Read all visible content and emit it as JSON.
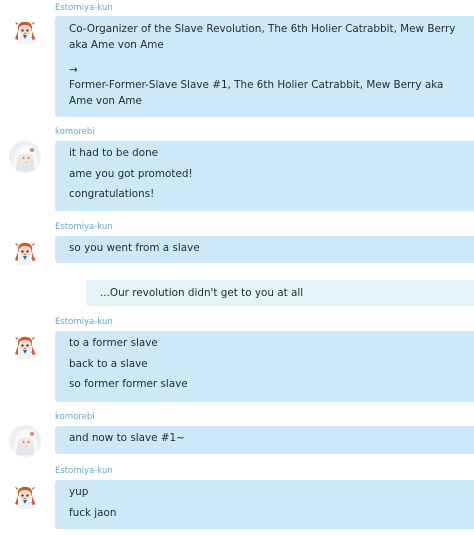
{
  "messages": [
    {
      "sender": "Estomiya-kun",
      "avatar": "chibi-redhead-avatar",
      "lines": [
        "Co-Organizer of the Slave Revolution, The 6th Holier Catrabbit, Mew Berry aka Ame von Ame",
        "→",
        "Former-Former-Slave Slave #1, The 6th Holier Catrabbit, Mew Berry aka Ame von Ame"
      ]
    },
    {
      "sender": "komorebi",
      "avatar": "white-haired-girl-avatar",
      "lines": [
        "it had to be done",
        "ame you got promoted!",
        "congratulations!"
      ]
    },
    {
      "sender": "Estomiya-kun",
      "avatar": "chibi-redhead-avatar",
      "lines": [
        "so you went from a slave"
      ]
    },
    {
      "system": "...Our revolution didn't get to you at all"
    },
    {
      "sender": "Estomiya-kun",
      "avatar": "chibi-redhead-avatar",
      "lines": [
        "to a former slave",
        "back to a slave",
        "so former former slave"
      ]
    },
    {
      "sender": "komorebi",
      "avatar": "white-haired-girl-avatar",
      "lines": [
        "and now to slave #1~"
      ]
    },
    {
      "sender": "Estomiya-kun",
      "avatar": "chibi-redhead-avatar",
      "lines": [
        "yup",
        "fuck jaon"
      ]
    }
  ],
  "colors": {
    "bubble": "#cde9f7",
    "system_bubble": "#e4f3fa",
    "sender_name": "#6aa7c7",
    "text": "#1e2a33"
  }
}
